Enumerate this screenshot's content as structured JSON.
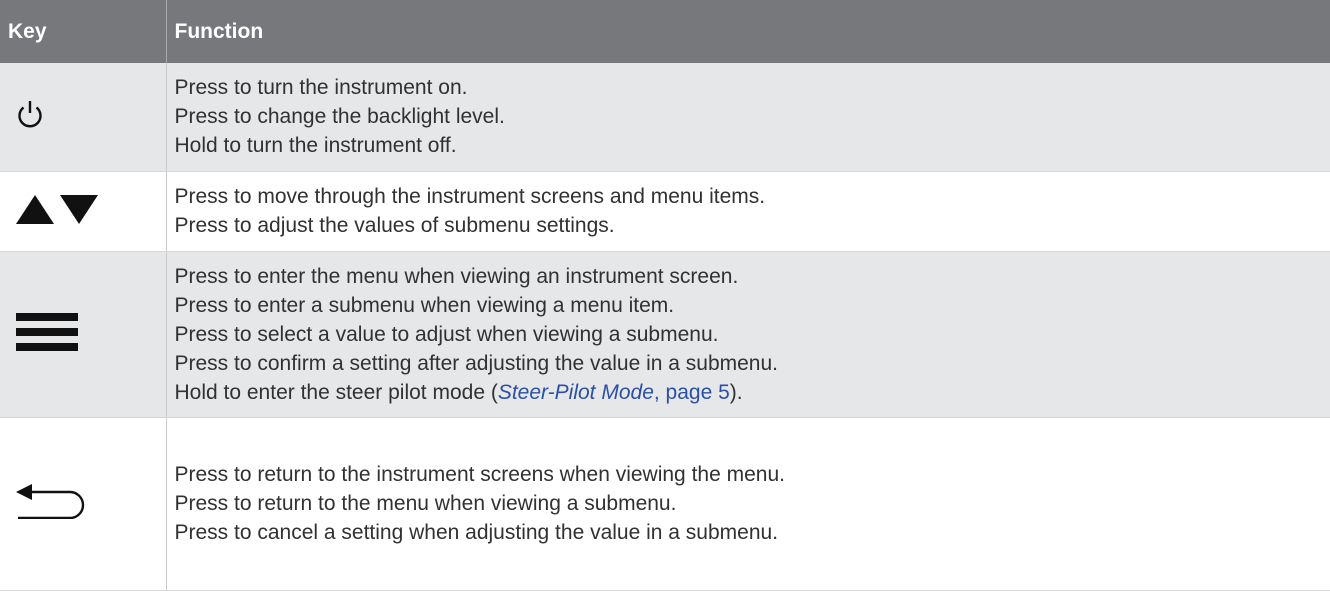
{
  "table": {
    "header": {
      "key": "Key",
      "function": "Function"
    },
    "rows": [
      {
        "icon": "power-icon",
        "lines": [
          "Press to turn the instrument on.",
          "Press to change the backlight level.",
          "Hold to turn the instrument off."
        ]
      },
      {
        "icon": "up-down-arrows-icon",
        "lines": [
          "Press to move through the instrument screens and menu items.",
          "Press to adjust the values of submenu settings."
        ]
      },
      {
        "icon": "menu-icon",
        "lines": [
          "Press to enter the menu when viewing an instrument screen.",
          "Press to enter a submenu when viewing a menu item.",
          "Press to select a value to adjust when viewing a submenu.",
          "Press to confirm a setting after adjusting the value in a submenu."
        ],
        "last_line": {
          "before": "Hold to enter the steer pilot mode (",
          "link_title": "Steer-Pilot Mode",
          "link_page": ", page 5",
          "after": ")."
        }
      },
      {
        "icon": "back-icon",
        "lines": [
          "Press to return to the instrument screens when viewing the menu.",
          "Press to return to the menu when viewing a submenu.",
          "Press to cancel a setting when adjusting the value in a submenu."
        ]
      }
    ]
  },
  "colors": {
    "header_bg": "#77787b",
    "row_shade": "#e6e7e8",
    "link": "#2b4fa8",
    "text": "#303132"
  }
}
